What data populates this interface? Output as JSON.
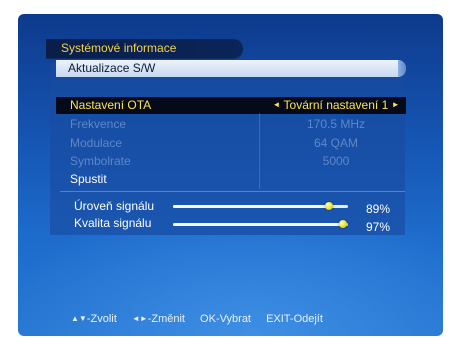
{
  "header": {
    "section_title": "Systémové informace"
  },
  "panel": {
    "title": "Aktualizace S/W"
  },
  "rows": [
    {
      "label": "Nastavení OTA",
      "value": "Tovární nastavení 1"
    },
    {
      "label": "Frekvence",
      "value": "170.5 MHz"
    },
    {
      "label": "Modulace",
      "value": "64 QAM"
    },
    {
      "label": "Symbolrate",
      "value": "5000"
    },
    {
      "label": "Spustit"
    }
  ],
  "signal": {
    "strength_label": "Úroveň signálu",
    "strength_value": "89%",
    "strength_level": 0.89,
    "quality_label": "Kvalita signálu",
    "quality_value": "97%",
    "quality_level": 0.97
  },
  "footer": {
    "select_glyph": "▲▼",
    "select_label": "-Zvolit",
    "change_glyph": "◄►",
    "change_label": "-Změnit",
    "ok_label": "OK-Vybrat",
    "exit_label": "EXIT-Odejít"
  },
  "colors": {
    "background_top": "#0d3a8c",
    "background_bottom": "#2777d2",
    "highlight_text": "#ffe24a",
    "disabled_text": "#5f87c7"
  }
}
